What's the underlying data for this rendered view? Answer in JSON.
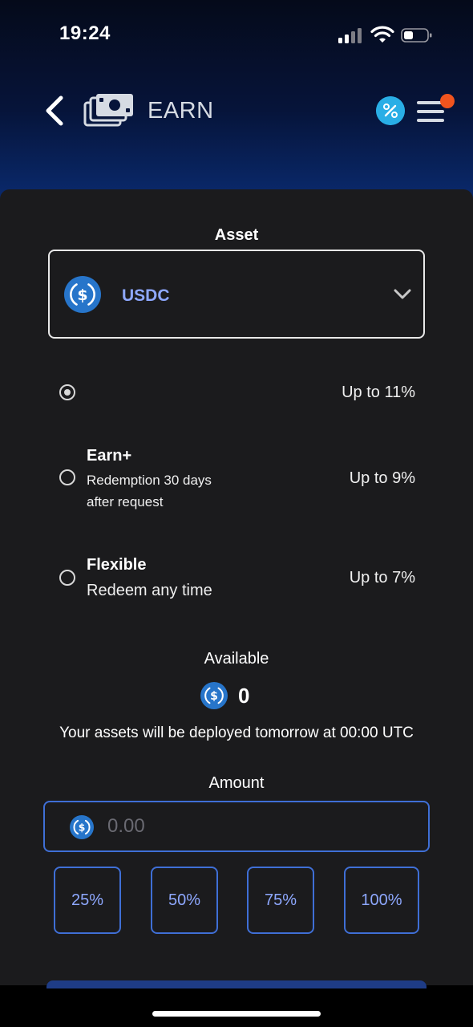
{
  "status_bar": {
    "time": "19:24"
  },
  "nav": {
    "title": "EARN"
  },
  "asset": {
    "label": "Asset",
    "selected": "USDC"
  },
  "options": [
    {
      "title": "",
      "description": "",
      "rate": "Up to 11%",
      "selected": true
    },
    {
      "title": "Earn+",
      "description_line1": "Redemption 30 days",
      "description_line2": "after request",
      "rate": "Up to 9%",
      "selected": false
    },
    {
      "title": "Flexible",
      "description": "Redeem any time",
      "rate": "Up to 7%",
      "selected": false
    }
  ],
  "available": {
    "label": "Available",
    "value": "0"
  },
  "deploy_note": "Your assets will be deployed tomorrow at 00:00 UTC",
  "amount": {
    "label": "Amount",
    "placeholder": "0.00",
    "value": ""
  },
  "percent_buttons": [
    "25%",
    "50%",
    "75%",
    "100%"
  ],
  "colors": {
    "accent_blue": "#3f6fd6",
    "link_blue": "#8ea8ff",
    "usdc_blue": "#2775ca",
    "notification": "#f0541e",
    "promo": "#29aee6"
  },
  "icons": [
    "back-icon",
    "earn-money-icon",
    "percent-badge-icon",
    "menu-icon",
    "usdc-icon",
    "chevron-down-icon",
    "signal-icon",
    "wifi-icon",
    "battery-icon"
  ]
}
